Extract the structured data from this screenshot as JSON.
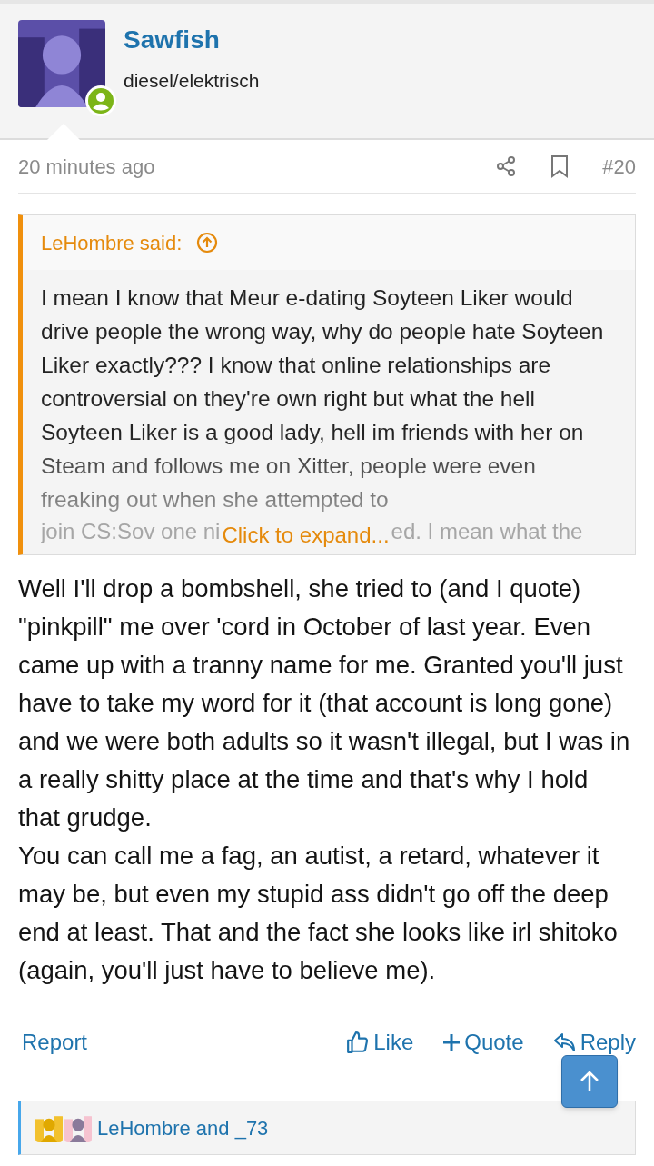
{
  "author": {
    "name": "Sawfish",
    "title": "diesel/elektrisch",
    "online": true
  },
  "meta": {
    "time": "20 minutes ago",
    "number": "#20"
  },
  "quote": {
    "header": "LeHombre said:",
    "lines": [
      "I mean I know that Meur e-dating Soyteen Liker would drive people the wrong way, why do people hate Soyteen Liker exactly??? I know that online relationships are controversial on they're own right but what the hell Soyteen Liker is a good lady, hell im friends with her on Steam and follows me on Xitter, people were even freaking out when she attempted to"
    ],
    "covered_line": [
      "join CS:Sov one ni",
      "ed. I mean what the"
    ],
    "expand": "Click to expand..."
  },
  "body": [
    "Well I'll drop a bombshell, she tried to (and I quote) \"pinkpill\" me over 'cord in October of last year. Even came up with a tranny name for me. Granted you'll just have to take my word for it (that account is long gone) and we were both adults so it wasn't illegal, but I was in a really shitty place at the time and that's why I hold that grudge.",
    "You can call me a fag, an autist, a retard, whatever it may be, but even my stupid ass didn't go off the deep end at least. That and the fact she looks like irl shitoko (again, you'll just have to believe me)."
  ],
  "actions": {
    "report": "Report",
    "like": "Like",
    "quote": "Quote",
    "reply": "Reply"
  },
  "reactions": {
    "text": "LeHombre and _73"
  }
}
